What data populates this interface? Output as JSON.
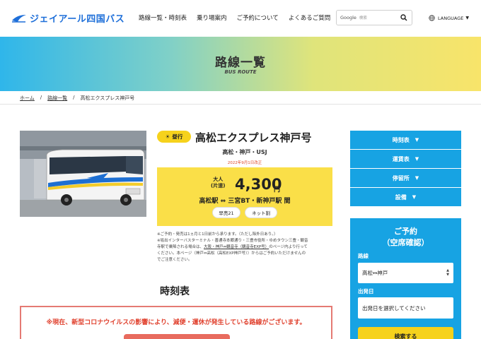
{
  "header": {
    "logo_text": "ジェイアール四国バス",
    "nav": [
      "路線一覧・時刻表",
      "乗り場案内",
      "ご予約について",
      "よくあるご質問"
    ],
    "search": {
      "brand": "Google",
      "placeholder": "検索"
    },
    "language_label": "LANGUAGE"
  },
  "hero": {
    "title": "路線一覧",
    "subtitle": "BUS ROUTE"
  },
  "breadcrumb": {
    "home": "ホーム",
    "routes": "路線一覧",
    "current": "高松エクスプレス神戸号"
  },
  "route": {
    "badge": "昼行",
    "title": "高松エクスプレス神戸号",
    "subtitle": "高松・神戸・USJ",
    "revised": "2022年9月1日改正",
    "fare_label": "大人\n(片道)",
    "fare_amount": "4,300",
    "fare_unit": "円",
    "stops": "高松駅 ⇔ 三宮BT・新神戸駅 間",
    "tags": [
      "早売21",
      "ネット割"
    ]
  },
  "notes": {
    "line1": "※ご予約・発売は1ヵ月と1日前から承ります。（ただし除外日あり。）",
    "line2": "※坂出インターバスターミナル・善通寺本郷通り・三豊市役所・ゆめタウン三豊・観音",
    "line3": "寺駅で乗降される場合は、",
    "link": "大阪・神戸⇔観音寺（観音寺EXP号）",
    "line3b": "のページ内より行って",
    "line4": "ください。本ページ（神戸⇔高松（高松EXP神戸号））からはご予約いただけませんの",
    "line5": "でご注意ください。"
  },
  "timetable": {
    "title": "時刻表",
    "warning": "※現在、新型コロナウイルスの影響により、減便・運休が発生している路線がございます。"
  },
  "sidebar": {
    "items": [
      "時刻表",
      "運賃表",
      "停留所",
      "設備"
    ],
    "reservation": {
      "title_line1": "ご予約",
      "title_line2": "（空席確認）",
      "route_label": "路線",
      "route_value": "高松↔神戸",
      "date_label": "出発日",
      "date_placeholder": "出発日を選択してください",
      "search_button": "検索する"
    }
  },
  "colors": {
    "accent_blue": "#17a3e3",
    "accent_yellow": "#fadf48",
    "warning_red": "#e0402d"
  }
}
